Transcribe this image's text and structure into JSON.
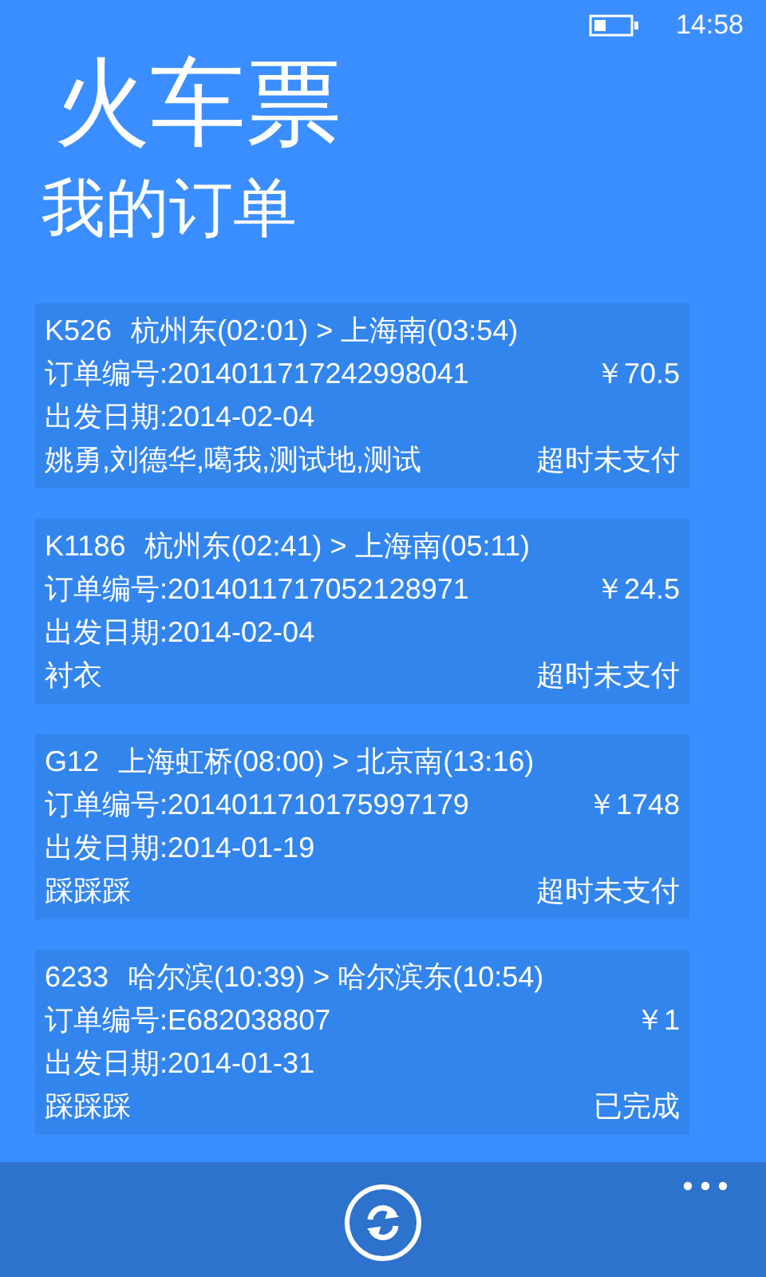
{
  "status_bar": {
    "time": "14:58"
  },
  "app_title": "火车票",
  "pivot": {
    "header": "我的订单"
  },
  "orders": [
    {
      "train": "K526",
      "route": "杭州东(02:01) > 上海南(03:54)",
      "order_no": "订单编号:2014011717242998041",
      "price": "￥70.5",
      "date": "出发日期:2014-02-04",
      "passengers": "姚勇,刘德华,噶我,测试地,测试",
      "status": "超时未支付"
    },
    {
      "train": "K1186",
      "route": "杭州东(02:41) > 上海南(05:11)",
      "order_no": "订单编号:2014011717052128971",
      "price": "￥24.5",
      "date": "出发日期:2014-02-04",
      "passengers": "衬衣",
      "status": "超时未支付"
    },
    {
      "train": "G12",
      "route": "上海虹桥(08:00) > 北京南(13:16)",
      "order_no": "订单编号:2014011710175997179",
      "price": "￥1748",
      "date": "出发日期:2014-01-19",
      "passengers": "踩踩踩",
      "status": "超时未支付"
    },
    {
      "train": "6233",
      "route": "哈尔滨(10:39) > 哈尔滨东(10:54)",
      "order_no": "订单编号:E682038807",
      "price": "￥1",
      "date": "出发日期:2014-01-31",
      "passengers": "踩踩踩",
      "status": "已完成"
    }
  ]
}
